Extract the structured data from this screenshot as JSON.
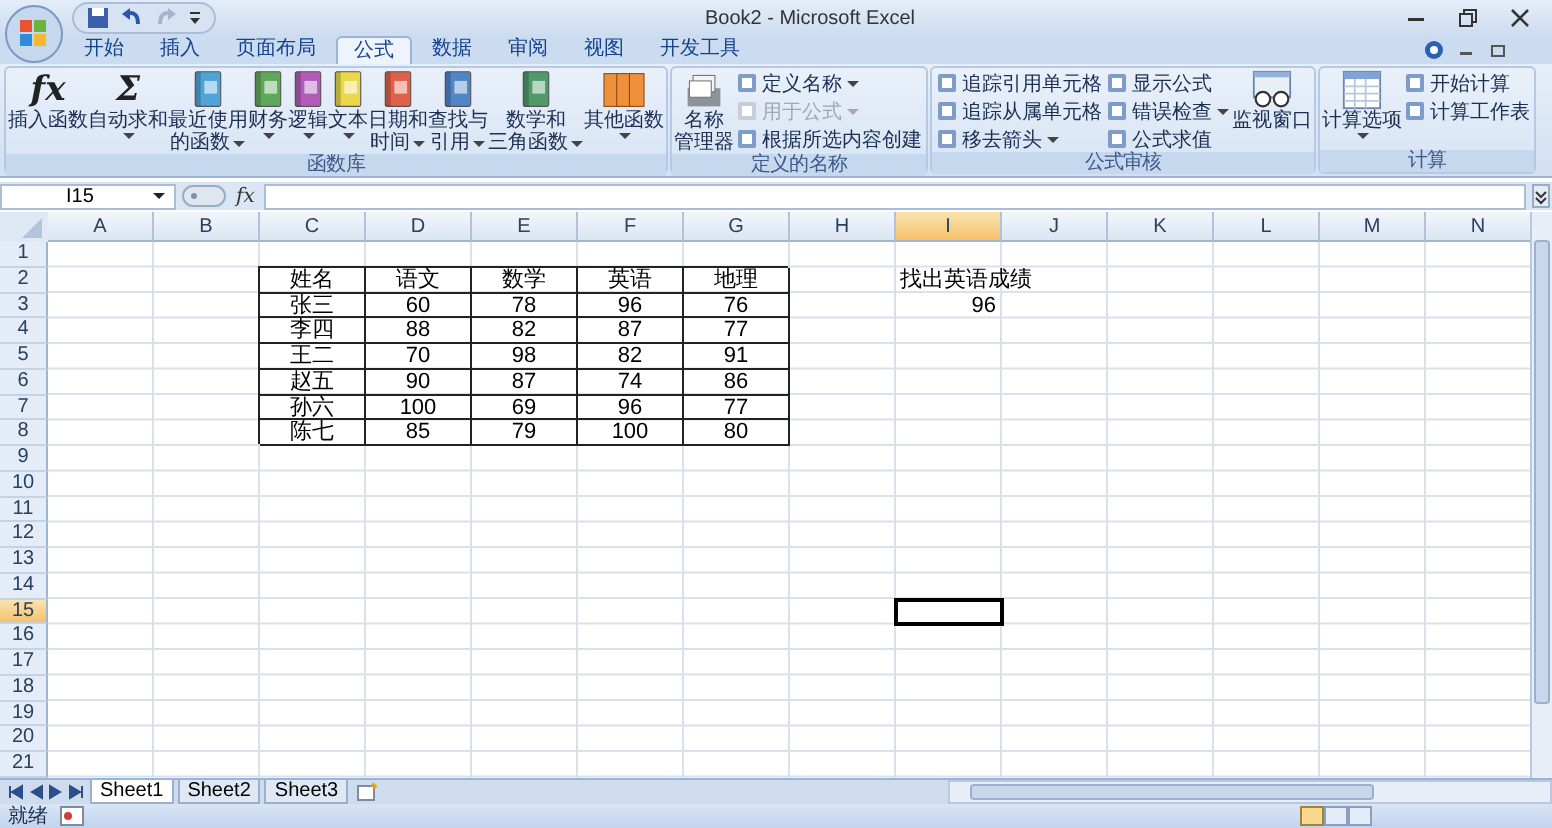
{
  "window": {
    "title": "Book2 - Microsoft Excel"
  },
  "tabs": [
    {
      "label": "开始",
      "selected": false
    },
    {
      "label": "插入",
      "selected": false
    },
    {
      "label": "页面布局",
      "selected": false
    },
    {
      "label": "公式",
      "selected": true
    },
    {
      "label": "数据",
      "selected": false
    },
    {
      "label": "审阅",
      "selected": false
    },
    {
      "label": "视图",
      "selected": false
    },
    {
      "label": "开发工具",
      "selected": false
    }
  ],
  "ribbon": [
    {
      "label": "函数库",
      "items": [
        {
          "kind": "glyph",
          "glyph": "fx",
          "lines": [
            "插入函数"
          ],
          "dropdown": false
        },
        {
          "kind": "glyph",
          "glyph": "Σ",
          "lines": [
            "自动求和"
          ],
          "dropdown": true
        },
        {
          "kind": "book",
          "color": "#4fa3d9",
          "lines": [
            "最近使用",
            "的函数"
          ],
          "dropdown": true
        },
        {
          "kind": "book",
          "color": "#5fa85a",
          "lines": [
            "财务"
          ],
          "dropdown": true
        },
        {
          "kind": "book",
          "color": "#b05cb8",
          "lines": [
            "逻辑"
          ],
          "dropdown": true
        },
        {
          "kind": "book",
          "color": "#e8d84a",
          "lines": [
            "文本"
          ],
          "dropdown": true
        },
        {
          "kind": "book",
          "color": "#e0604a",
          "lines": [
            "日期和",
            "时间"
          ],
          "dropdown": true
        },
        {
          "kind": "book",
          "color": "#4f86c6",
          "lines": [
            "查找与",
            "引用"
          ],
          "dropdown": true
        },
        {
          "kind": "book",
          "color": "#4f9a6a",
          "lines": [
            "数学和",
            "三角函数"
          ],
          "dropdown": true
        },
        {
          "kind": "books",
          "color": "#f0903a",
          "lines": [
            "其他函数"
          ],
          "dropdown": true
        }
      ]
    },
    {
      "label": "定义的名称",
      "items": [
        {
          "kind": "names",
          "lines": [
            "名称",
            "管理器"
          ],
          "dropdown": false
        },
        {
          "kind": "stack",
          "items": [
            {
              "label": "定义名称",
              "dropdown": true,
              "disabled": false
            },
            {
              "label": "用于公式",
              "dropdown": true,
              "disabled": true
            },
            {
              "label": "根据所选内容创建",
              "dropdown": false,
              "disabled": false
            }
          ]
        }
      ]
    },
    {
      "label": "公式审核",
      "items": [
        {
          "kind": "stack",
          "items": [
            {
              "label": "追踪引用单元格",
              "dropdown": false,
              "disabled": false
            },
            {
              "label": "追踪从属单元格",
              "dropdown": false,
              "disabled": false
            },
            {
              "label": "移去箭头",
              "dropdown": true,
              "disabled": false
            }
          ]
        },
        {
          "kind": "stack",
          "items": [
            {
              "label": "显示公式",
              "dropdown": false,
              "disabled": false
            },
            {
              "label": "错误检查",
              "dropdown": true,
              "disabled": false
            },
            {
              "label": "公式求值",
              "dropdown": false,
              "disabled": false
            }
          ]
        },
        {
          "kind": "watch",
          "lines": [
            "监视窗口"
          ],
          "dropdown": false
        }
      ]
    },
    {
      "label": "计算",
      "items": [
        {
          "kind": "calc",
          "lines": [
            "计算选项"
          ],
          "dropdown": true
        },
        {
          "kind": "stack",
          "items": [
            {
              "label": "开始计算",
              "dropdown": false,
              "disabled": false
            },
            {
              "label": "计算工作表",
              "dropdown": false,
              "disabled": false
            }
          ]
        }
      ]
    }
  ],
  "formula_bar": {
    "name_box": "I15",
    "function_button": "fx"
  },
  "columns": [
    {
      "label": "A",
      "selected": false
    },
    {
      "label": "B",
      "selected": false
    },
    {
      "label": "C",
      "selected": false
    },
    {
      "label": "D",
      "selected": false
    },
    {
      "label": "E",
      "selected": false
    },
    {
      "label": "F",
      "selected": false
    },
    {
      "label": "G",
      "selected": false
    },
    {
      "label": "H",
      "selected": false
    },
    {
      "label": "I",
      "selected": true
    },
    {
      "label": "J",
      "selected": false
    },
    {
      "label": "K",
      "selected": false
    },
    {
      "label": "L",
      "selected": false
    },
    {
      "label": "M",
      "selected": false
    },
    {
      "label": "N",
      "selected": false
    }
  ],
  "rows": [
    {
      "label": "1",
      "selected": false
    },
    {
      "label": "2",
      "selected": false
    },
    {
      "label": "3",
      "selected": false
    },
    {
      "label": "4",
      "selected": false
    },
    {
      "label": "5",
      "selected": false
    },
    {
      "label": "6",
      "selected": false
    },
    {
      "label": "7",
      "selected": false
    },
    {
      "label": "8",
      "selected": false
    },
    {
      "label": "9",
      "selected": false
    },
    {
      "label": "10",
      "selected": false
    },
    {
      "label": "11",
      "selected": false
    },
    {
      "label": "12",
      "selected": false
    },
    {
      "label": "13",
      "selected": false
    },
    {
      "label": "14",
      "selected": false
    },
    {
      "label": "15",
      "selected": true
    },
    {
      "label": "16",
      "selected": false
    },
    {
      "label": "17",
      "selected": false
    },
    {
      "label": "18",
      "selected": false
    },
    {
      "label": "19",
      "selected": false
    },
    {
      "label": "20",
      "selected": false
    },
    {
      "label": "21",
      "selected": false
    }
  ],
  "table": [
    [
      "姓名",
      "语文",
      "数学",
      "英语",
      "地理"
    ],
    [
      "张三",
      "60",
      "78",
      "96",
      "76"
    ],
    [
      "李四",
      "88",
      "82",
      "87",
      "77"
    ],
    [
      "王二",
      "70",
      "98",
      "82",
      "91"
    ],
    [
      "赵五",
      "90",
      "87",
      "74",
      "86"
    ],
    [
      "孙六",
      "100",
      "69",
      "96",
      "77"
    ],
    [
      "陈七",
      "85",
      "79",
      "100",
      "80"
    ]
  ],
  "lookup": {
    "label": "找出英语成绩",
    "value": "96"
  },
  "sheet_tabs": [
    {
      "label": "Sheet1",
      "selected": true
    },
    {
      "label": "Sheet2",
      "selected": false
    },
    {
      "label": "Sheet3",
      "selected": false
    }
  ],
  "status_bar": {
    "text": "就绪"
  }
}
